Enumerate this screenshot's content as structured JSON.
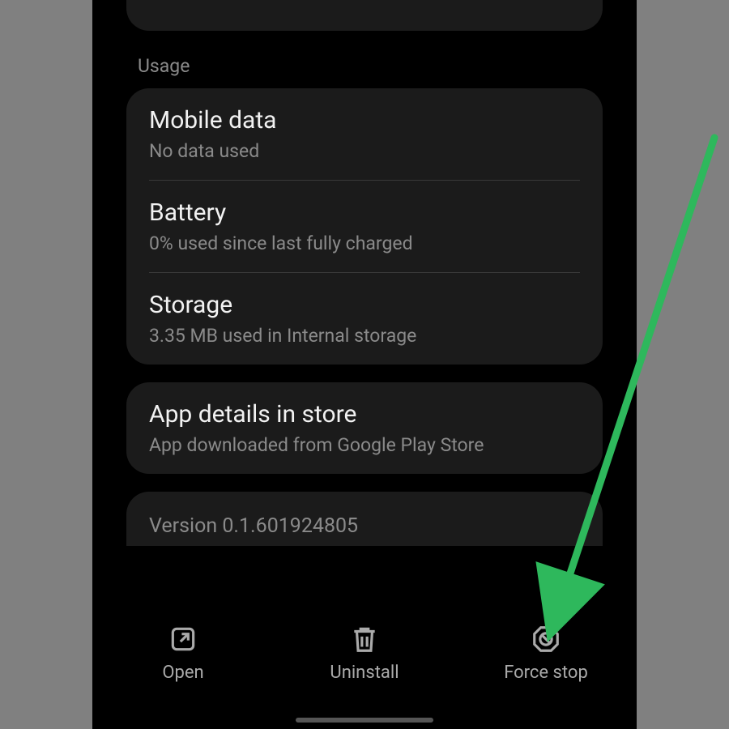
{
  "section_header": "Usage",
  "usage": {
    "mobile_data": {
      "title": "Mobile data",
      "sub": "No data used"
    },
    "battery": {
      "title": "Battery",
      "sub": "0% used since last fully charged"
    },
    "storage": {
      "title": "Storage",
      "sub": "3.35 MB used in Internal storage"
    }
  },
  "store": {
    "title": "App details in store",
    "sub": "App downloaded from Google Play Store"
  },
  "version_label": "Version 0.1.601924805",
  "bottom": {
    "open": "Open",
    "uninstall": "Uninstall",
    "force_stop": "Force stop"
  }
}
